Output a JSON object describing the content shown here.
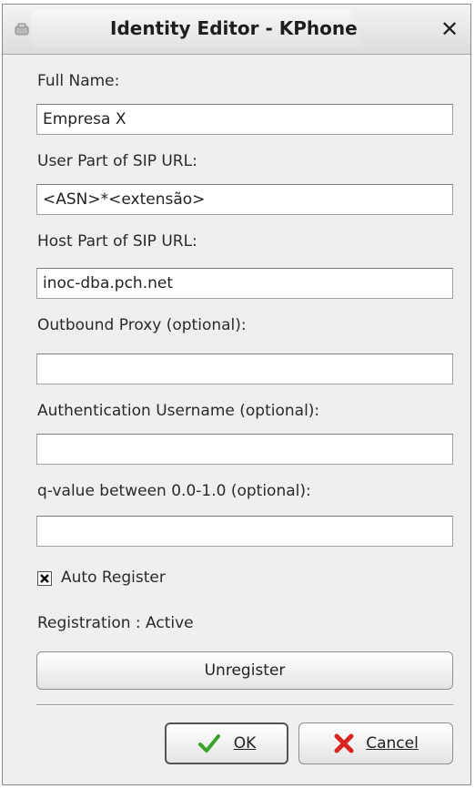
{
  "window": {
    "title": "Identity Editor - KPhone",
    "close_symbol": "✕"
  },
  "fields": [
    {
      "label": "Full Name:",
      "value": "Empresa X"
    },
    {
      "label": "User Part of SIP URL:",
      "value": "<ASN>*<extensão>"
    },
    {
      "label": "Host Part of SIP URL:",
      "value": "inoc-dba.pch.net"
    },
    {
      "label": "Outbound Proxy (optional):",
      "value": ""
    },
    {
      "label": "Authentication Username (optional):",
      "value": ""
    },
    {
      "label": "q-value between 0.0-1.0 (optional):",
      "value": ""
    }
  ],
  "auto_register": {
    "label": "Auto Register",
    "checked": true
  },
  "registration_status": "Registration : Active",
  "buttons": {
    "unregister": "Unregister",
    "ok": "OK",
    "cancel": "Cancel"
  },
  "icons": {
    "app": "kphone-app-icon",
    "ok": "checkmark-icon",
    "cancel": "red-x-icon",
    "close": "close-icon"
  },
  "colors": {
    "ok_icon": "#3aa22a",
    "cancel_icon": "#d7261e"
  }
}
